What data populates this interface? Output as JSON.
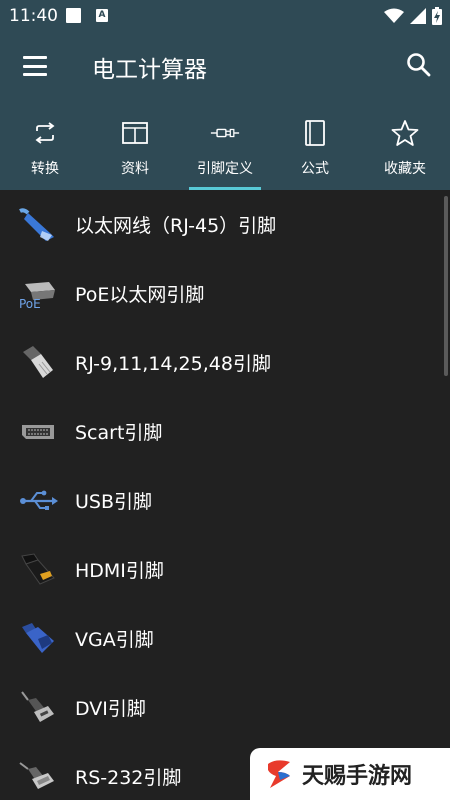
{
  "status": {
    "time": "11:40",
    "notif_letter": "A"
  },
  "app": {
    "title": "电工计算器"
  },
  "tabs": [
    {
      "label": "转换",
      "icon": "repeat-icon"
    },
    {
      "label": "资料",
      "icon": "book-open-icon"
    },
    {
      "label": "引脚定义",
      "icon": "connector-icon",
      "active": true
    },
    {
      "label": "公式",
      "icon": "book-icon"
    },
    {
      "label": "收藏夹",
      "icon": "star-icon"
    }
  ],
  "items": [
    {
      "label": "以太网线（RJ-45）引脚",
      "icon": "ethernet-cable-icon"
    },
    {
      "label": "PoE以太网引脚",
      "icon": "poe-icon",
      "icon_text": "PoE"
    },
    {
      "label": "RJ-9,11,14,25,48引脚",
      "icon": "rj11-plug-icon"
    },
    {
      "label": "Scart引脚",
      "icon": "scart-plug-icon"
    },
    {
      "label": "USB引脚",
      "icon": "usb-icon"
    },
    {
      "label": "HDMI引脚",
      "icon": "hdmi-plug-icon"
    },
    {
      "label": "VGA引脚",
      "icon": "vga-plug-icon"
    },
    {
      "label": "DVI引脚",
      "icon": "dvi-plug-icon"
    },
    {
      "label": "RS-232引脚",
      "icon": "rs232-plug-icon"
    }
  ],
  "watermark": {
    "text": "天赐手游网"
  },
  "colors": {
    "primary": "#2f4a55",
    "accent": "#58c9d6",
    "background": "#212121"
  }
}
